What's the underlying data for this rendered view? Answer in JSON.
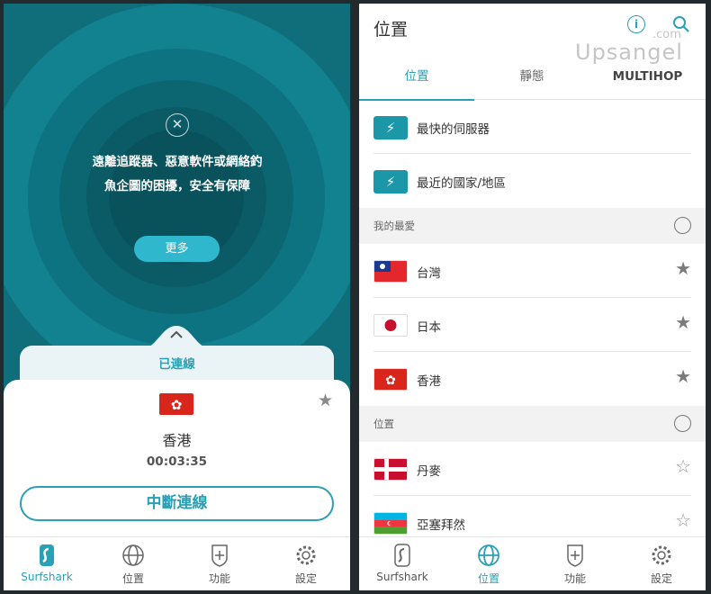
{
  "left": {
    "warning_text": "遠離追蹤器、惡意軟件或網絡釣魚企圖的困擾，安全有保障",
    "more_button": "更多",
    "status": "已連線",
    "country": "香港",
    "timer": "00:03:35",
    "disconnect_button": "中斷連線",
    "nav": [
      {
        "label": "Surfshark",
        "icon": "surfshark-logo-icon",
        "active": true
      },
      {
        "label": "位置",
        "icon": "globe-icon"
      },
      {
        "label": "功能",
        "icon": "shield-plus-icon"
      },
      {
        "label": "設定",
        "icon": "gear-icon"
      }
    ]
  },
  "right": {
    "title": "位置",
    "watermark": {
      "domain": ".com",
      "brand": "Upsangel"
    },
    "tabs": [
      "位置",
      "靜態",
      "MULTIHOP"
    ],
    "active_tab": "位置",
    "quick": [
      {
        "label": "最快的伺服器",
        "icon": "lightning-icon"
      },
      {
        "label": "最近的國家/地區",
        "icon": "lightning-icon"
      }
    ],
    "favorites_header": "我的最愛",
    "favorites": [
      {
        "label": "台灣",
        "flag": "taiwan-flag",
        "starred": true
      },
      {
        "label": "日本",
        "flag": "japan-flag",
        "starred": true
      },
      {
        "label": "香港",
        "flag": "hong-kong-flag",
        "starred": true
      }
    ],
    "locations_header": "位置",
    "locations": [
      {
        "label": "丹麥",
        "flag": "denmark-flag",
        "starred": false
      },
      {
        "label": "亞塞拜然",
        "flag": "azerbaijan-flag",
        "starred": false
      }
    ],
    "nav": [
      {
        "label": "Surfshark",
        "icon": "surfshark-logo-icon"
      },
      {
        "label": "位置",
        "icon": "globe-icon",
        "active": true
      },
      {
        "label": "功能",
        "icon": "shield-plus-icon"
      },
      {
        "label": "設定",
        "icon": "gear-icon"
      }
    ]
  },
  "colors": {
    "accent": "#2aa0b5",
    "dark_bg": "#0f6e79",
    "hk_red": "#d9261c"
  }
}
